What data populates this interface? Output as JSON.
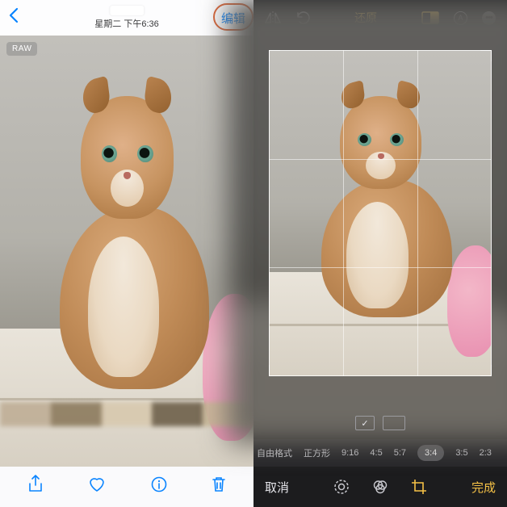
{
  "left": {
    "timestamp": "星期二 下午6:36",
    "edit_label": "编辑",
    "raw_badge": "RAW",
    "toolbar": {
      "share": "分享",
      "favorite": "喜欢",
      "info": "信息",
      "trash": "删除"
    }
  },
  "right": {
    "revert_label": "还原",
    "ratio_options": [
      "自由格式",
      "正方形",
      "9:16",
      "4:5",
      "5:7",
      "3:4",
      "3:5",
      "2:3"
    ],
    "ratio_selected": "3:4",
    "cancel_label": "取消",
    "done_label": "完成"
  }
}
